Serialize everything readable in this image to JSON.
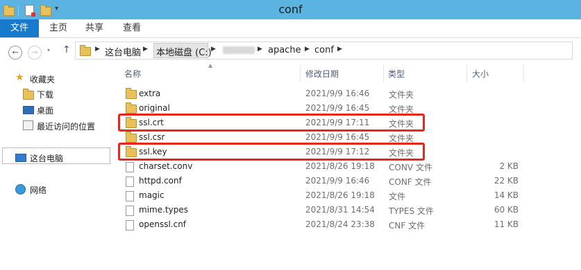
{
  "window": {
    "title": "conf"
  },
  "ribbon": {
    "tabs": [
      "文件",
      "主页",
      "共享",
      "查看"
    ]
  },
  "address": {
    "segments": [
      "这台电脑",
      "本地磁盘 (C:)",
      "apache",
      "conf"
    ]
  },
  "nav": {
    "favorites": "收藏夹",
    "downloads": "下载",
    "desktop": "桌面",
    "recent": "最近访问的位置",
    "this_pc": "这台电脑",
    "network": "网络"
  },
  "columns": {
    "name": "名称",
    "modified": "修改日期",
    "type": "类型",
    "size": "大小"
  },
  "files": [
    {
      "name": "extra",
      "modified": "2021/9/9 16:46",
      "type": "文件夹",
      "size": "",
      "kind": "folder"
    },
    {
      "name": "original",
      "modified": "2021/9/9 16:45",
      "type": "文件夹",
      "size": "",
      "kind": "folder"
    },
    {
      "name": "ssl.crt",
      "modified": "2021/9/9 17:11",
      "type": "文件夹",
      "size": "",
      "kind": "folder"
    },
    {
      "name": "ssl.csr",
      "modified": "2021/9/9 16:45",
      "type": "文件夹",
      "size": "",
      "kind": "folder"
    },
    {
      "name": "ssl.key",
      "modified": "2021/9/9 17:12",
      "type": "文件夹",
      "size": "",
      "kind": "folder"
    },
    {
      "name": "charset.conv",
      "modified": "2021/8/26 19:18",
      "type": "CONV 文件",
      "size": "2 KB",
      "kind": "file"
    },
    {
      "name": "httpd.conf",
      "modified": "2021/9/9 16:46",
      "type": "CONF 文件",
      "size": "22 KB",
      "kind": "file"
    },
    {
      "name": "magic",
      "modified": "2021/8/26 19:18",
      "type": "文件",
      "size": "14 KB",
      "kind": "file"
    },
    {
      "name": "mime.types",
      "modified": "2021/8/31 14:54",
      "type": "TYPES 文件",
      "size": "60 KB",
      "kind": "file"
    },
    {
      "name": "openssl.cnf",
      "modified": "2021/8/24 23:38",
      "type": "CNF 文件",
      "size": "11 KB",
      "kind": "file"
    }
  ],
  "colors": {
    "titlebar": "#5ab3e0",
    "file_tab": "#1979ca",
    "highlight": "#e8261c"
  }
}
